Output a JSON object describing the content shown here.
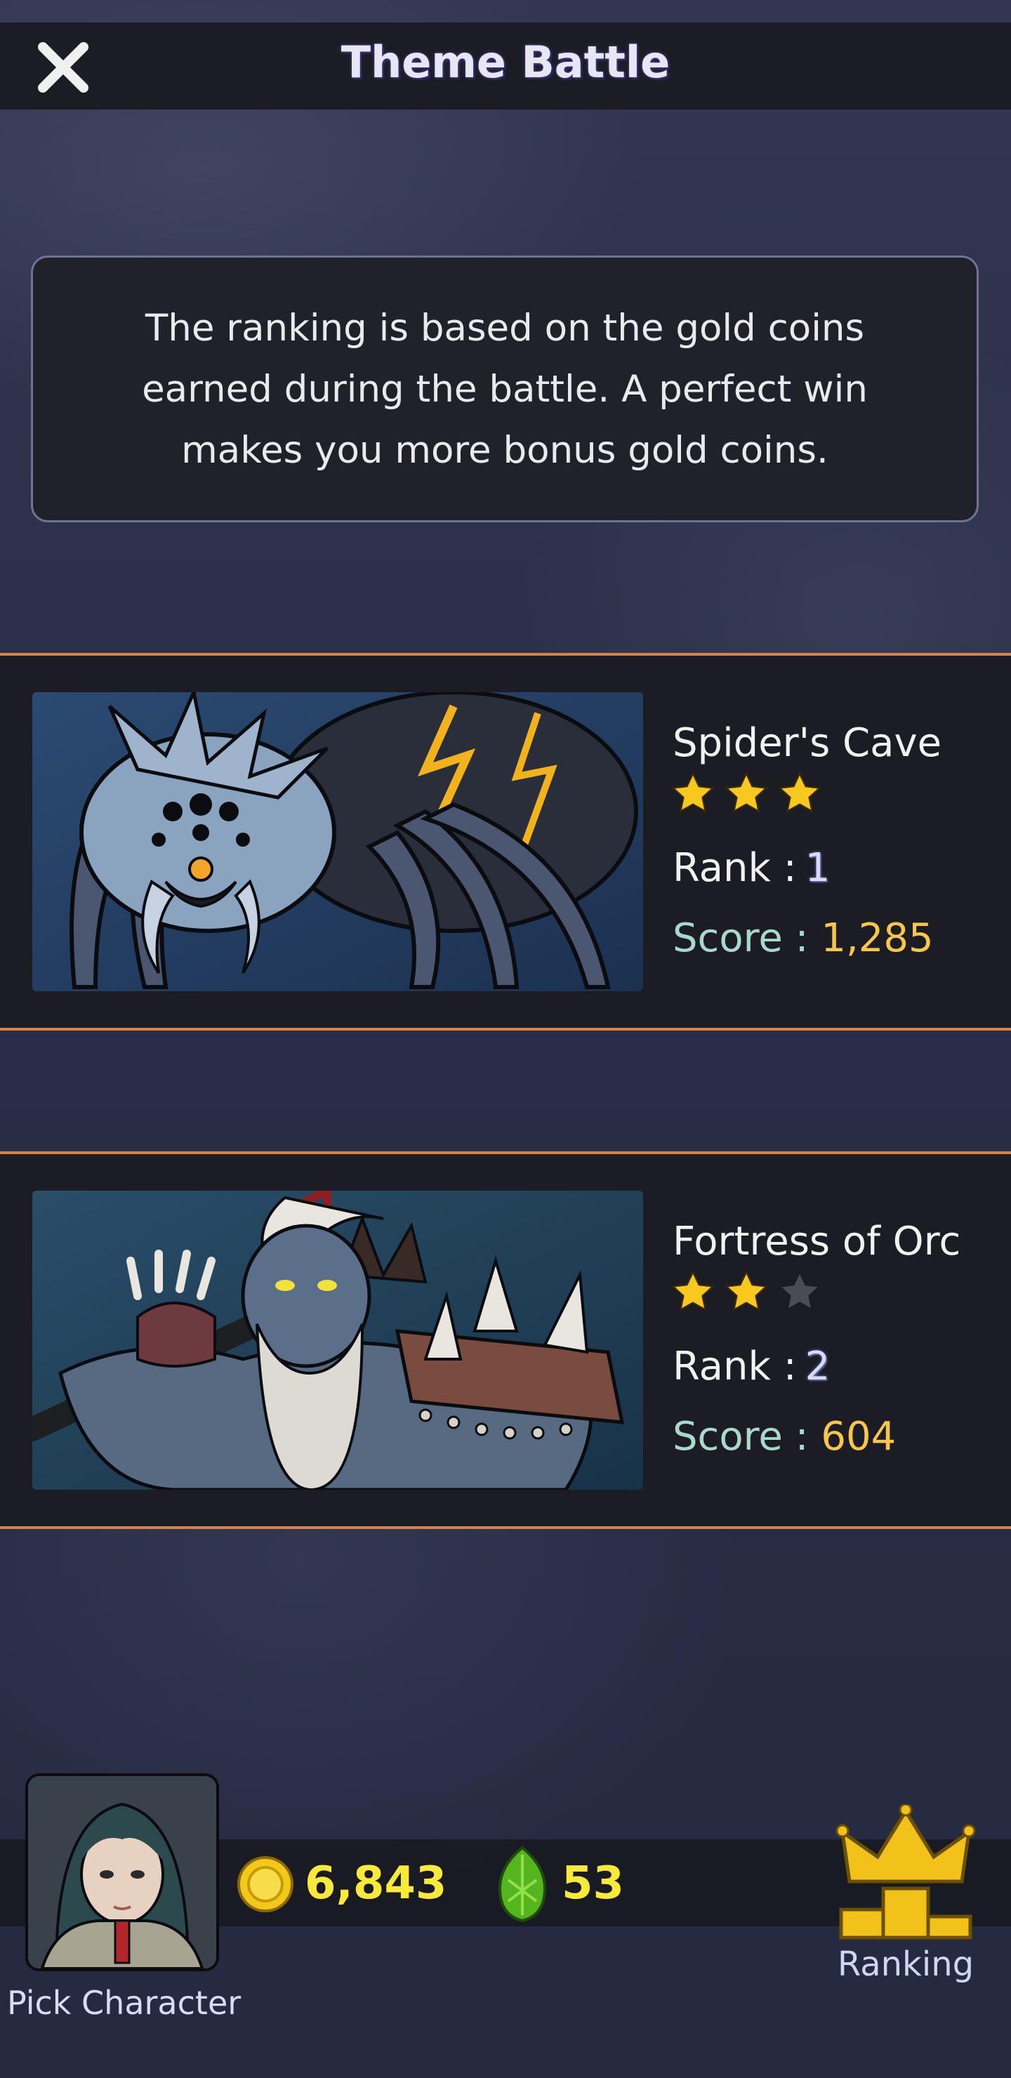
{
  "header": {
    "title": "Theme Battle"
  },
  "info": {
    "text": "The ranking is based on the gold coins earned during the battle. A perfect win makes you more bonus gold coins."
  },
  "themes": [
    {
      "name": "Spider's Cave",
      "stars": 3,
      "max_stars": 3,
      "rank_label": "Rank :",
      "rank": "1",
      "score_label": "Score :",
      "score": "1,285"
    },
    {
      "name": "Fortress of Orc",
      "stars": 2,
      "max_stars": 3,
      "rank_label": "Rank :",
      "rank": "2",
      "score_label": "Score :",
      "score": "604"
    }
  ],
  "footer": {
    "pick_character_label": "Pick Character",
    "coins": "6,843",
    "gems": "53",
    "ranking_label": "Ranking"
  },
  "colors": {
    "accent_border": "#d4834a",
    "score_value": "#f6c74a",
    "star_on": "#f7c81e",
    "star_off": "#4a4c55"
  },
  "icons": [
    "close-icon",
    "star-icon",
    "gold-coin-icon",
    "green-gem-icon",
    "crown-podium-icon"
  ]
}
